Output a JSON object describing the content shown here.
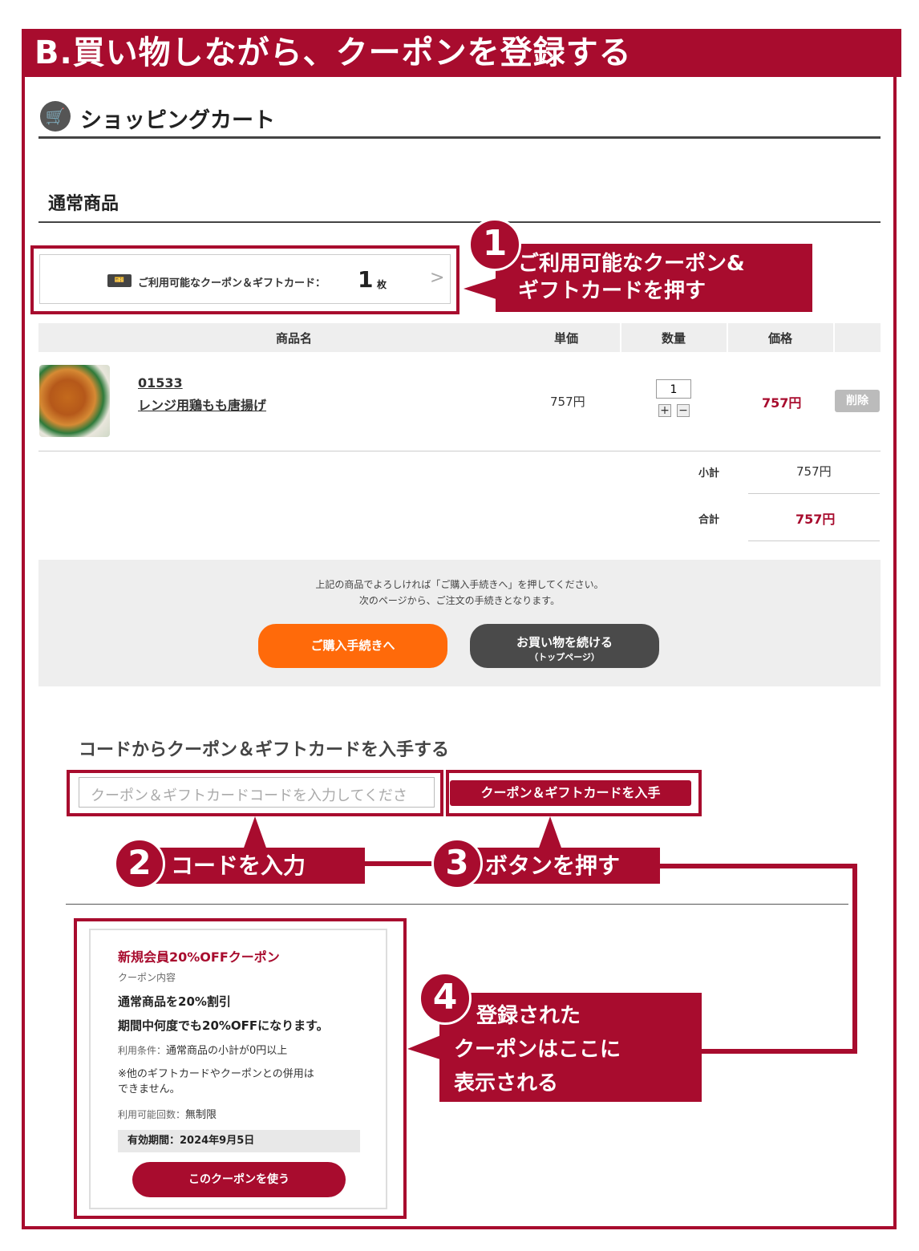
{
  "banner": {
    "title": "B.買い物しながら、クーポンを登録する"
  },
  "cart": {
    "icon": "cart-icon",
    "title": "ショッピングカート"
  },
  "section": {
    "title": "通常商品"
  },
  "coupon_button": {
    "label": "ご利用可能なクーポン＆ギフトカード：",
    "count": "1",
    "unit": "枚",
    "icon": "ticket-icon"
  },
  "callouts": {
    "c1": {
      "number": "1",
      "lines": [
        "ご利用可能なクーポン&",
        "ギフトカードを押す"
      ]
    },
    "c2": {
      "number": "2",
      "text": "コードを入力"
    },
    "c3": {
      "number": "3",
      "text": "ボタンを押す"
    },
    "c4": {
      "number": "4",
      "lines": [
        "登録された",
        "クーポンはここに",
        "表示される"
      ]
    }
  },
  "table": {
    "headers": [
      "商品名",
      "単価",
      "数量",
      "価格"
    ],
    "row": {
      "code": "01533",
      "name": "レンジ用鶏もも唐揚げ",
      "unit_price": "757円",
      "quantity": "1",
      "price": "757円",
      "delete_label": "削除"
    }
  },
  "totals": {
    "subtotal_label": "小計",
    "subtotal": "757円",
    "total_label": "合計",
    "total": "757円"
  },
  "checkout": {
    "message_1": "上記の商品でよろしければ「ご購入手続きへ」を押してください。",
    "message_2": "次のページから、ご注文の手続きとなります。",
    "purchase_label": "ご購入手続きへ",
    "continue_label": "お買い物を続ける",
    "continue_sub": "（トップページ）"
  },
  "code_section": {
    "title": "コードからクーポン＆ギフトカードを入手する",
    "placeholder": "クーポン＆ギフトカードコードを入力してくださ",
    "button_label": "クーポン＆ギフトカードを入手"
  },
  "coupon": {
    "title": "新規会員20%OFFクーポン",
    "content_label": "クーポン内容",
    "line1": "通常商品を20%割引",
    "line2": "期間中何度でも20%OFFになります。",
    "condition_label": "利用条件：",
    "condition": "通常商品の小計が0円以上",
    "note_1": "※他のギフトカードやクーポンとの併用は",
    "note_2": "できません。",
    "usage_label": "利用可能回数：",
    "usage": "無制限",
    "validity": "有効期間：2024年9月5日",
    "use_button": "このクーポンを使う"
  },
  "colors": {
    "brand": "#a80c2e",
    "orange": "#ff6a0a",
    "dark_button": "#4a4a4a"
  }
}
